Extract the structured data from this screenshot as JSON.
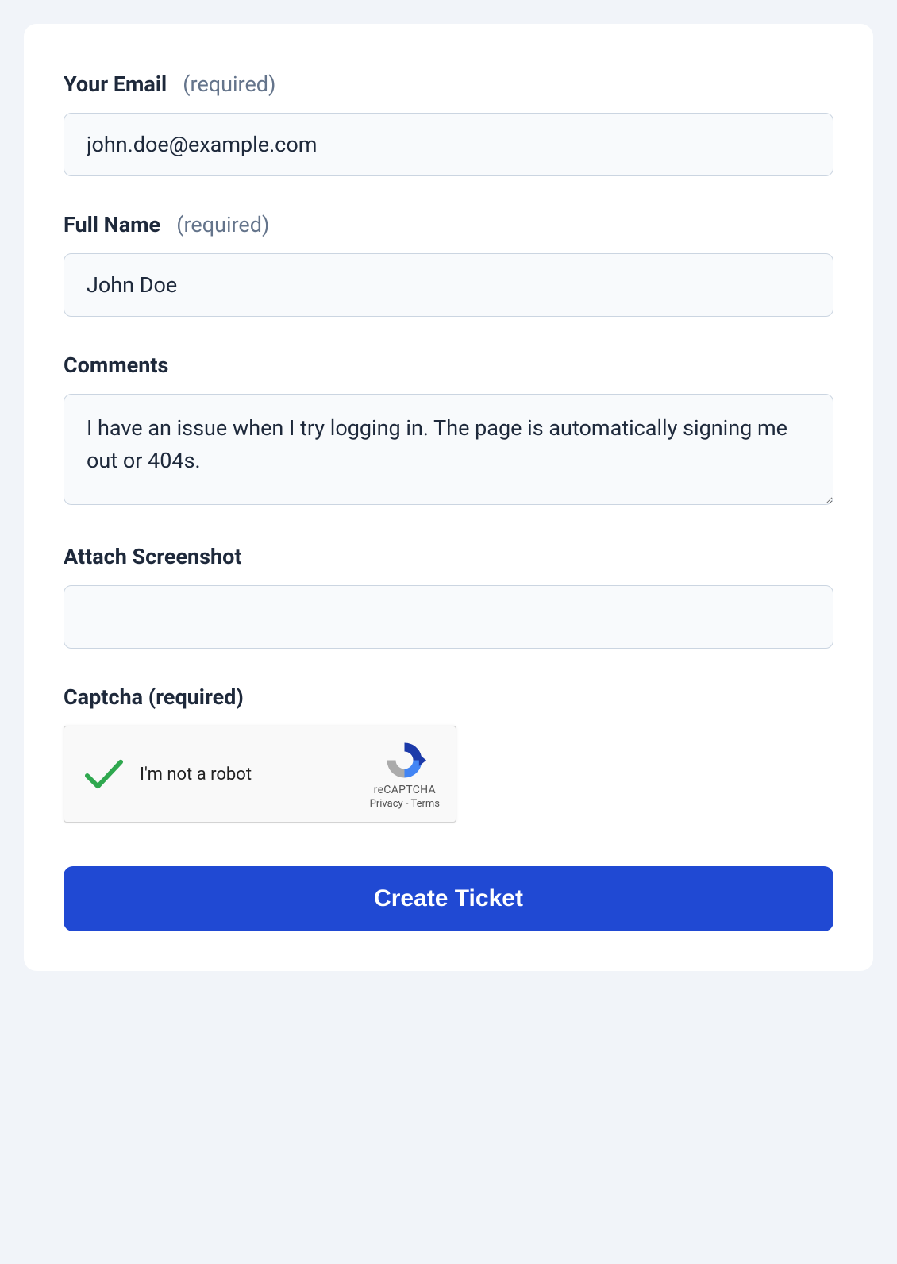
{
  "form": {
    "email": {
      "label": "Your Email",
      "required_note": "(required)",
      "value": "john.doe@example.com"
    },
    "fullname": {
      "label": "Full Name",
      "required_note": "(required)",
      "value": "John Doe"
    },
    "comments": {
      "label": "Comments",
      "value": "I have an issue when I try logging in. The page is automatically signing me out or 404s."
    },
    "screenshot": {
      "label": "Attach Screenshot"
    },
    "captcha": {
      "label": "Captcha (required)",
      "checkbox_text": "I'm not a robot",
      "brand": "reCAPTCHA",
      "privacy": "Privacy",
      "sep": " - ",
      "terms": "Terms"
    },
    "submit_label": "Create Ticket"
  }
}
